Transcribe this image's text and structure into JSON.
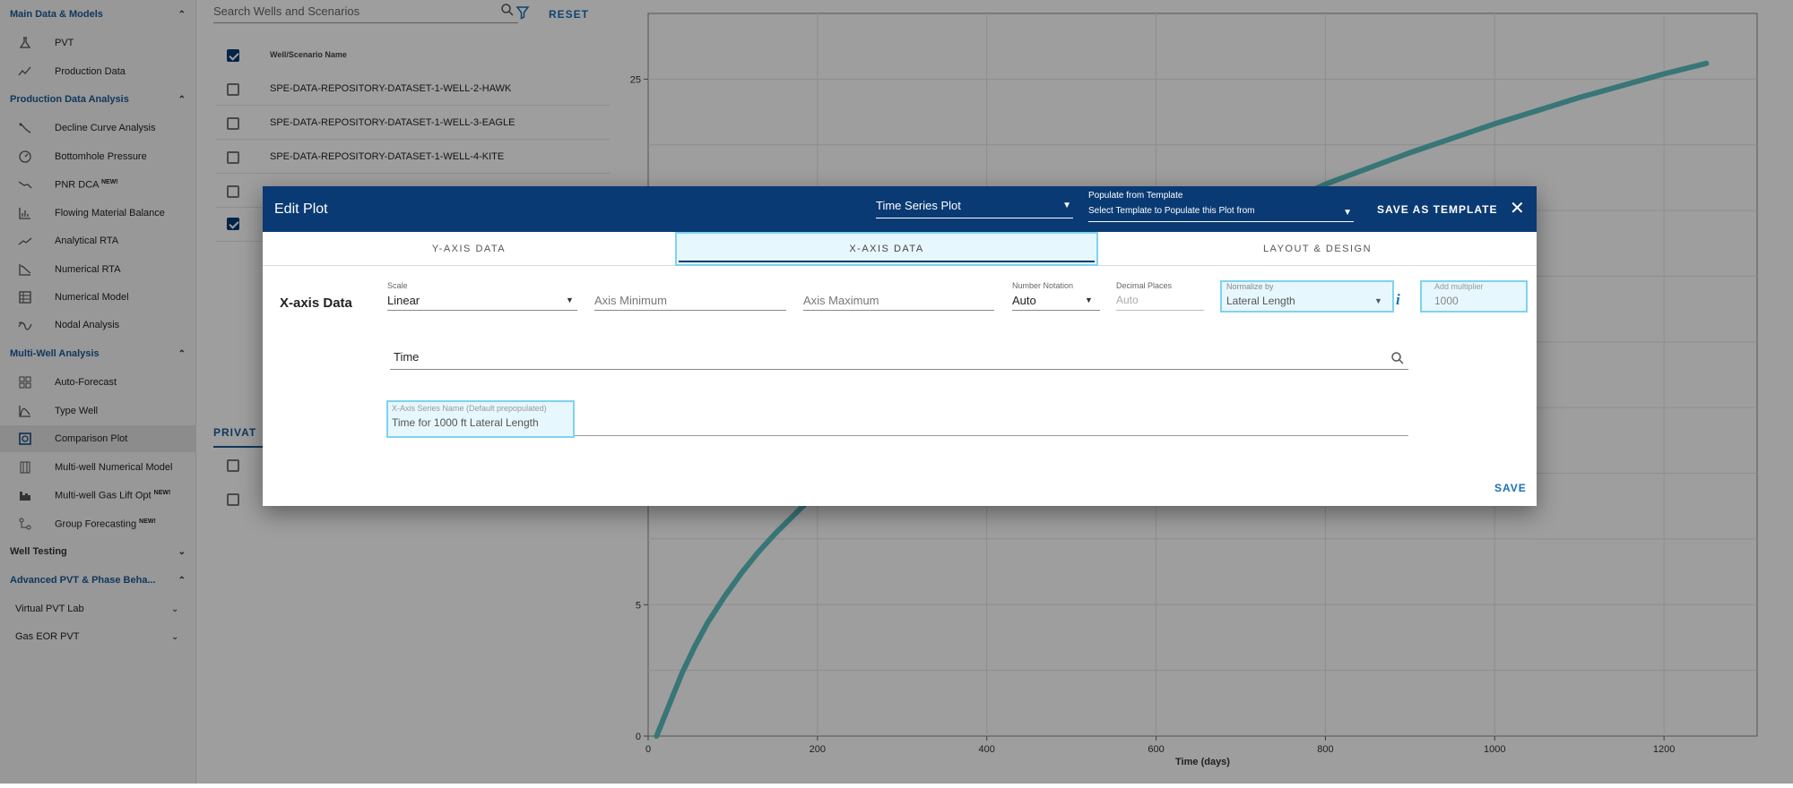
{
  "sidebar": {
    "sections": [
      {
        "label": "Main Data & Models",
        "expanded": true
      },
      {
        "label": "Production Data Analysis",
        "expanded": true
      },
      {
        "label": "Multi-Well Analysis",
        "expanded": true
      },
      {
        "label": "Well Testing",
        "expanded": false
      },
      {
        "label": "Advanced PVT & Phase Beha...",
        "expanded": true
      }
    ],
    "items": [
      {
        "label": "PVT",
        "icon": "flask-icon"
      },
      {
        "label": "Production Data",
        "icon": "line-chart-icon"
      },
      {
        "label": "Decline Curve Analysis",
        "icon": "decline-icon"
      },
      {
        "label": "Bottomhole Pressure",
        "icon": "gauge-icon"
      },
      {
        "label": "PNR DCA",
        "badge": "NEW!",
        "icon": "trend-down-icon"
      },
      {
        "label": "Flowing Material Balance",
        "icon": "bar-chart-icon"
      },
      {
        "label": "Analytical RTA",
        "icon": "trend-icon"
      },
      {
        "label": "Numerical RTA",
        "icon": "curve-icon"
      },
      {
        "label": "Numerical Model",
        "icon": "grid-icon"
      },
      {
        "label": "Nodal Analysis",
        "icon": "wave-icon"
      },
      {
        "label": "Auto-Forecast",
        "icon": "dashboard-icon"
      },
      {
        "label": "Type Well",
        "icon": "bell-curve-icon"
      },
      {
        "label": "Comparison Plot",
        "icon": "compare-icon"
      },
      {
        "label": "Multi-well Numerical Model",
        "icon": "columns-icon"
      },
      {
        "label": "Multi-well Gas Lift Opt",
        "badge": "NEW!",
        "icon": "factory-icon"
      },
      {
        "label": "Group Forecasting",
        "badge": "NEW!",
        "icon": "nodes-icon"
      }
    ],
    "subsections": [
      {
        "label": "Virtual PVT Lab"
      },
      {
        "label": "Gas EOR PVT"
      }
    ]
  },
  "wells": {
    "search_placeholder": "Search Wells and Scenarios",
    "reset_label": "RESET",
    "column_header": "Well/Scenario Name",
    "rows": [
      {
        "name": "SPE-DATA-REPOSITORY-DATASET-1-WELL-2-HAWK",
        "checked": false
      },
      {
        "name": "SPE-DATA-REPOSITORY-DATASET-1-WELL-3-EAGLE",
        "checked": false
      },
      {
        "name": "SPE-DATA-REPOSITORY-DATASET-1-WELL-4-KITE",
        "checked": false
      }
    ],
    "private_tab": "PRIVAT"
  },
  "chart_data": {
    "type": "line",
    "xlabel": "Time (days)",
    "x_ticks": [
      0,
      200,
      400,
      600,
      800,
      1000,
      1200
    ],
    "y_ticks_visible": [
      0,
      5,
      25
    ],
    "xlim": [
      0,
      1310
    ],
    "ylim": [
      0,
      27.5
    ],
    "grid": true,
    "series": [
      {
        "color": "#5bbfc0",
        "points": [
          [
            10,
            0
          ],
          [
            25,
            1.2
          ],
          [
            40,
            2.4
          ],
          [
            55,
            3.4
          ],
          [
            70,
            4.3
          ],
          [
            90,
            5.3
          ],
          [
            110,
            6.2
          ],
          [
            130,
            7
          ],
          [
            150,
            7.7
          ],
          [
            200,
            9.3
          ],
          [
            250,
            10.8
          ],
          [
            300,
            12.1
          ],
          [
            400,
            14.4
          ],
          [
            500,
            16.3
          ],
          [
            600,
            18
          ],
          [
            700,
            19.5
          ],
          [
            800,
            21
          ],
          [
            900,
            22.2
          ],
          [
            1000,
            23.3
          ],
          [
            1100,
            24.3
          ],
          [
            1200,
            25.2
          ],
          [
            1250,
            25.6
          ]
        ]
      }
    ]
  },
  "modal": {
    "title": "Edit Plot",
    "plot_type": "Time Series Plot",
    "template_label": "Populate from Template",
    "template_placeholder": "Select Template to Populate this Plot from",
    "save_template": "SAVE AS TEMPLATE",
    "tabs": [
      "Y-AXIS DATA",
      "X-AXIS DATA",
      "LAYOUT & DESIGN"
    ],
    "section_title": "X-axis Data",
    "scale_label": "Scale",
    "scale_value": "Linear",
    "axis_min_placeholder": "Axis Minimum",
    "axis_max_placeholder": "Axis Maximum",
    "notation_label": "Number Notation",
    "notation_value": "Auto",
    "decimal_label": "Decimal Places",
    "decimal_placeholder": "Auto",
    "normalize_label": "Normalize by",
    "normalize_value": "Lateral Length",
    "multiplier_label": "Add multiplier",
    "multiplier_value": "1000",
    "time_value": "Time",
    "series_name_label": "X-Axis Series Name (Default prepopulated)",
    "series_name_value": "Time for 1000 ft Lateral Length",
    "save": "SAVE"
  }
}
